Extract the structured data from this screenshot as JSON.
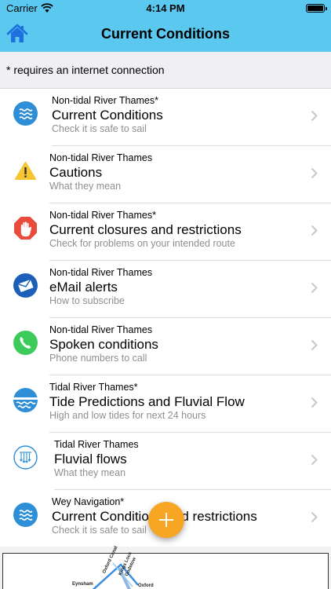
{
  "status_bar": {
    "carrier": "Carrier",
    "time": "4:14 PM"
  },
  "nav": {
    "title": "Current Conditions",
    "home_icon": "home-icon"
  },
  "info": {
    "text": "* requires an internet connection"
  },
  "rows": [
    {
      "icon": "waves-icon",
      "kicker": "Non-tidal River Thames*",
      "title": "Current Conditions",
      "subtitle": "Check it is safe to sail"
    },
    {
      "icon": "warning-icon",
      "kicker": "Non-tidal River Thames",
      "title": "Cautions",
      "subtitle": "What they mean"
    },
    {
      "icon": "stop-hand-icon",
      "kicker": "Non-tidal River Thames*",
      "title": "Current closures and restrictions",
      "subtitle": "Check for problems on your intended route"
    },
    {
      "icon": "email-icon",
      "kicker": "Non-tidal River Thames",
      "title": "eMail alerts",
      "subtitle": "How to subscribe"
    },
    {
      "icon": "phone-icon",
      "kicker": "Non-tidal River Thames",
      "title": "Spoken conditions",
      "subtitle": "Phone numbers to call"
    },
    {
      "icon": "tide-icon",
      "kicker": "Tidal River Thames*",
      "title": "Tide Predictions and Fluvial Flow",
      "subtitle": "High and low tides for next 24 hours"
    },
    {
      "icon": "fluvial-flow-icon",
      "kicker": "Tidal River Thames",
      "title": "Fluvial flows",
      "subtitle": "What they mean"
    },
    {
      "icon": "waves-icon",
      "kicker": "Wey Navigation*",
      "title": "Current Conditions and restrictions",
      "subtitle": "Check it is safe to sail"
    }
  ],
  "map": {
    "labels": [
      "Oxford Canal",
      "Kings Lock",
      "Godstow",
      "Eynsham",
      "Oxford"
    ]
  },
  "colors": {
    "accent": "#5bc8f0",
    "fab": "#f6a623",
    "icon_blue": "#2f8fd6",
    "warning": "#f7c531",
    "stop": "#e94b3c",
    "phone": "#3ccb5a"
  }
}
